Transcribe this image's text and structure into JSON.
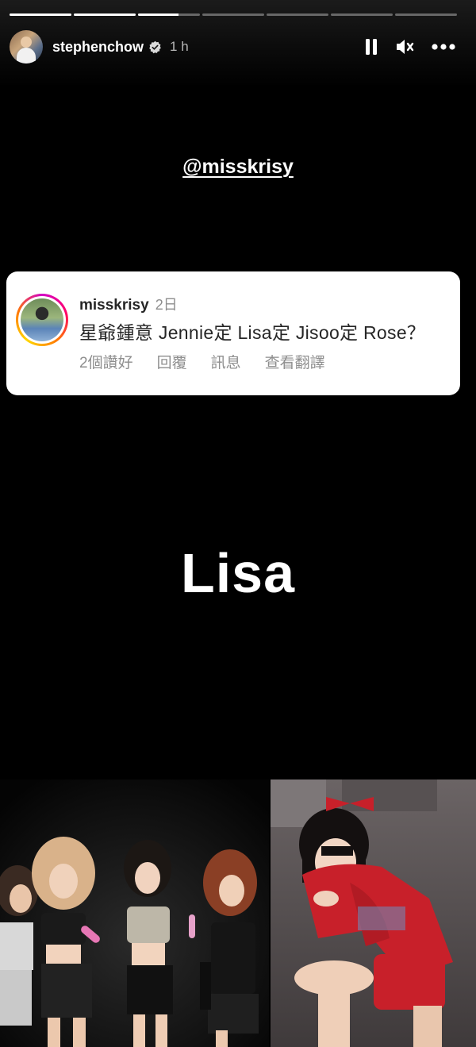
{
  "story": {
    "progress_fills": [
      1,
      1,
      0.65,
      0,
      0,
      0,
      0
    ]
  },
  "header": {
    "username": "stephenchow",
    "time": "1 h"
  },
  "mention": {
    "text": "@misskrisy"
  },
  "comment_card": {
    "username": "misskrisy",
    "age": "2日",
    "text": "星爺鍾意 Jennie定 Lisa定 Jisoo定 Rose？",
    "actions": [
      "2個讚好",
      "回覆",
      "訊息",
      "查看翻譯"
    ]
  },
  "answer": {
    "text": "Lisa"
  },
  "colors": {
    "background": "#000000",
    "card": "#ffffff",
    "muted": "#8e8e8e",
    "outfit_red": "#c8202a"
  },
  "icons": [
    "verified-icon",
    "pause-icon",
    "mute-icon",
    "more-icon"
  ]
}
